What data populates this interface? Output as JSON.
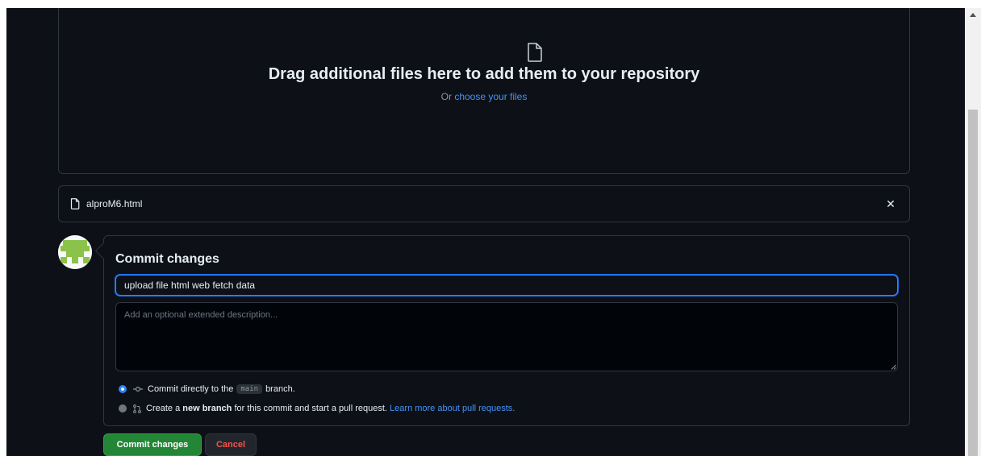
{
  "dropzone": {
    "icon": "file-icon",
    "title": "Drag additional files here to add them to your repository",
    "or_text": "Or ",
    "choose_link": "choose your files"
  },
  "uploaded_file": {
    "icon": "file-icon",
    "name": "alproM6.html",
    "remove_icon": "close-icon",
    "remove_glyph": "✕"
  },
  "commit": {
    "title": "Commit changes",
    "summary_value": "upload file html web fetch data",
    "description_placeholder": "Add an optional extended description...",
    "options": {
      "direct": {
        "selected": true,
        "icon": "git-commit-icon",
        "text_before": "Commit directly to the",
        "branch": "main",
        "text_after": "branch."
      },
      "new_branch": {
        "selected": false,
        "icon": "git-pull-request-icon",
        "text_before": "Create a",
        "bold": "new branch",
        "text_after": "for this commit and start a pull request.",
        "learn_more": "Learn more about pull requests."
      }
    }
  },
  "buttons": {
    "commit_label": "Commit changes",
    "cancel_label": "Cancel"
  },
  "colors": {
    "background": "#0d1117",
    "border": "#30363d",
    "link": "#4493f8",
    "primary_button": "#238636",
    "danger_text": "#f85149",
    "focus": "#2f81f7"
  }
}
